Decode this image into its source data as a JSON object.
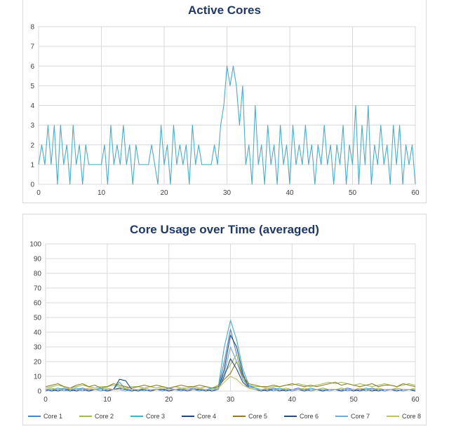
{
  "chart_data": [
    {
      "type": "line",
      "title": "Active Cores",
      "xlabel": "",
      "ylabel": "",
      "xlim": [
        0,
        60
      ],
      "ylim": [
        0,
        8
      ],
      "x_ticks": [
        0,
        10,
        20,
        30,
        40,
        50,
        60
      ],
      "y_ticks": [
        0,
        1,
        2,
        3,
        4,
        5,
        6,
        7,
        8
      ],
      "grid": true,
      "legend": "none",
      "series": [
        {
          "color": "#4bacc6",
          "x": [
            0,
            0.5,
            1,
            1.5,
            2,
            2.5,
            3,
            3.5,
            4,
            4.5,
            5,
            5.5,
            6,
            6.5,
            7,
            7.5,
            8,
            8.5,
            9,
            9.5,
            10,
            10.5,
            11,
            11.5,
            12,
            12.5,
            13,
            13.5,
            14,
            14.5,
            15,
            15.5,
            16,
            16.5,
            17,
            17.5,
            18,
            18.5,
            19,
            19.5,
            20,
            20.5,
            21,
            21.5,
            22,
            22.5,
            23,
            23.5,
            24,
            24.5,
            25,
            25.5,
            26,
            26.5,
            27,
            27.5,
            28,
            28.5,
            29,
            29.5,
            30,
            30.5,
            31,
            31.5,
            32,
            32.5,
            33,
            33.5,
            34,
            34.5,
            35,
            35.5,
            36,
            36.5,
            37,
            37.5,
            38,
            38.5,
            39,
            39.5,
            40,
            40.5,
            41,
            41.5,
            42,
            42.5,
            43,
            43.5,
            44,
            44.5,
            45,
            45.5,
            46,
            46.5,
            47,
            47.5,
            48,
            48.5,
            49,
            49.5,
            50,
            50.5,
            51,
            51.5,
            52,
            52.5,
            53,
            53.5,
            54,
            54.5,
            55,
            55.5,
            56,
            56.5,
            57,
            57.5,
            58,
            58.5,
            59,
            59.5,
            60
          ],
          "values": [
            1,
            2,
            1,
            3,
            1,
            3,
            0,
            3,
            1,
            2,
            0,
            3,
            1,
            2,
            0,
            2,
            1,
            1,
            1,
            1,
            1,
            2,
            0,
            3,
            1,
            2,
            1,
            3,
            1,
            2,
            0,
            2,
            1,
            1,
            1,
            1,
            2,
            1,
            0,
            3,
            1,
            2,
            0,
            3,
            1,
            2,
            1,
            2,
            0,
            3,
            1,
            2,
            1,
            1,
            1,
            1,
            2,
            1,
            3,
            4,
            6,
            5,
            6,
            5,
            3,
            5,
            1,
            2,
            0,
            4,
            1,
            2,
            0,
            3,
            1,
            2,
            0,
            3,
            1,
            2,
            0,
            3,
            1,
            2,
            1,
            3,
            1,
            2,
            0,
            2,
            1,
            3,
            1,
            2,
            0,
            2,
            1,
            3,
            0,
            2,
            1,
            4,
            0,
            3,
            1,
            4,
            0,
            2,
            1,
            3,
            1,
            2,
            0,
            3,
            1,
            3,
            0,
            2,
            1,
            2,
            0
          ]
        }
      ]
    },
    {
      "type": "line",
      "title": "Core Usage over Time (averaged)",
      "xlabel": "",
      "ylabel": "",
      "xlim": [
        0,
        60
      ],
      "ylim": [
        0,
        100
      ],
      "x_ticks": [
        0,
        10,
        20,
        30,
        40,
        50,
        60
      ],
      "y_ticks": [
        0,
        10,
        20,
        30,
        40,
        50,
        60,
        70,
        80,
        90,
        100
      ],
      "grid": true,
      "legend": "bottom",
      "x": [
        0,
        1,
        2,
        3,
        4,
        5,
        6,
        7,
        8,
        9,
        10,
        11,
        12,
        13,
        14,
        15,
        16,
        17,
        18,
        19,
        20,
        21,
        22,
        23,
        24,
        25,
        26,
        27,
        28,
        29,
        30,
        31,
        32,
        33,
        34,
        35,
        36,
        37,
        38,
        39,
        40,
        41,
        42,
        43,
        44,
        45,
        46,
        47,
        48,
        49,
        50,
        51,
        52,
        53,
        54,
        55,
        56,
        57,
        58,
        59,
        60
      ],
      "series": [
        {
          "name": "Core 1",
          "color": "#4f81bd",
          "values": [
            1,
            2,
            1,
            2,
            1,
            1,
            2,
            1,
            1,
            2,
            1,
            1,
            2,
            1,
            1,
            1,
            2,
            1,
            1,
            1,
            2,
            1,
            1,
            1,
            2,
            1,
            1,
            1,
            2,
            20,
            42,
            25,
            10,
            3,
            2,
            1,
            1,
            2,
            1,
            1,
            1,
            2,
            1,
            1,
            1,
            2,
            1,
            1,
            1,
            2,
            1,
            1,
            1,
            2,
            1,
            1,
            1,
            2,
            1,
            1,
            1
          ]
        },
        {
          "name": "Core 2",
          "color": "#9bbb59",
          "values": [
            2,
            3,
            4,
            3,
            2,
            3,
            4,
            3,
            2,
            3,
            3,
            4,
            3,
            2,
            3,
            3,
            2,
            3,
            2,
            3,
            2,
            3,
            2,
            2,
            3,
            2,
            3,
            2,
            4,
            12,
            18,
            25,
            8,
            4,
            3,
            3,
            2,
            3,
            3,
            4,
            4,
            5,
            4,
            3,
            4,
            5,
            6,
            5,
            6,
            5,
            4,
            5,
            4,
            3,
            4,
            5,
            4,
            3,
            4,
            5,
            4
          ]
        },
        {
          "name": "Core 3",
          "color": "#4bacc6",
          "values": [
            1,
            1,
            2,
            1,
            1,
            2,
            1,
            1,
            1,
            2,
            1,
            1,
            6,
            1,
            1,
            1,
            2,
            1,
            1,
            1,
            1,
            1,
            2,
            1,
            1,
            1,
            1,
            2,
            2,
            30,
            48,
            35,
            15,
            4,
            2,
            1,
            1,
            1,
            2,
            1,
            1,
            1,
            1,
            2,
            1,
            1,
            1,
            1,
            2,
            1,
            1,
            1,
            2,
            1,
            1,
            1,
            1,
            2,
            1,
            1,
            1
          ]
        },
        {
          "name": "Core 4",
          "color": "#1f497d",
          "values": [
            0,
            1,
            0,
            1,
            1,
            0,
            1,
            0,
            1,
            1,
            0,
            1,
            8,
            7,
            1,
            0,
            1,
            0,
            1,
            1,
            0,
            1,
            0,
            1,
            1,
            0,
            1,
            0,
            1,
            15,
            38,
            30,
            12,
            2,
            1,
            0,
            1,
            1,
            0,
            1,
            0,
            1,
            1,
            0,
            1,
            0,
            1,
            1,
            0,
            1,
            0,
            1,
            1,
            0,
            1,
            0,
            1,
            1,
            0,
            1,
            0
          ]
        },
        {
          "name": "Core 5",
          "color": "#8c7b2c",
          "values": [
            3,
            4,
            5,
            3,
            2,
            4,
            5,
            3,
            4,
            2,
            3,
            5,
            4,
            3,
            2,
            3,
            4,
            3,
            4,
            3,
            2,
            3,
            4,
            3,
            3,
            4,
            3,
            2,
            3,
            8,
            12,
            20,
            10,
            5,
            4,
            3,
            3,
            4,
            3,
            4,
            5,
            4,
            3,
            4,
            3,
            4,
            5,
            6,
            4,
            5,
            4,
            3,
            4,
            5,
            3,
            4,
            4,
            3,
            5,
            4,
            3
          ]
        },
        {
          "name": "Core 6",
          "color": "#2c4d75",
          "values": [
            1,
            0,
            1,
            1,
            0,
            1,
            1,
            0,
            1,
            1,
            0,
            1,
            2,
            1,
            0,
            1,
            1,
            0,
            1,
            1,
            0,
            1,
            1,
            0,
            1,
            1,
            0,
            1,
            1,
            10,
            22,
            15,
            6,
            2,
            1,
            1,
            0,
            1,
            1,
            0,
            1,
            1,
            0,
            1,
            1,
            0,
            1,
            1,
            0,
            1,
            1,
            0,
            1,
            1,
            0,
            1,
            1,
            0,
            1,
            1,
            0
          ]
        },
        {
          "name": "Core 7",
          "color": "#6fa8dc",
          "values": [
            0,
            1,
            1,
            0,
            1,
            1,
            0,
            1,
            1,
            0,
            1,
            1,
            1,
            0,
            1,
            1,
            0,
            1,
            1,
            0,
            1,
            1,
            0,
            1,
            1,
            0,
            1,
            1,
            1,
            12,
            30,
            20,
            8,
            2,
            1,
            1,
            1,
            0,
            1,
            1,
            0,
            1,
            1,
            0,
            1,
            1,
            0,
            1,
            1,
            0,
            1,
            1,
            0,
            1,
            1,
            0,
            1,
            1,
            0,
            1,
            1
          ]
        },
        {
          "name": "Core 8",
          "color": "#c4bd6e",
          "values": [
            1,
            2,
            1,
            1,
            2,
            1,
            1,
            2,
            1,
            1,
            2,
            1,
            1,
            2,
            1,
            1,
            2,
            1,
            1,
            2,
            1,
            1,
            2,
            1,
            1,
            2,
            1,
            1,
            2,
            6,
            10,
            8,
            4,
            2,
            1,
            1,
            2,
            1,
            1,
            2,
            1,
            1,
            2,
            1,
            1,
            2,
            1,
            1,
            2,
            1,
            1,
            2,
            1,
            1,
            2,
            1,
            1,
            2,
            1,
            1,
            2
          ]
        }
      ]
    }
  ]
}
